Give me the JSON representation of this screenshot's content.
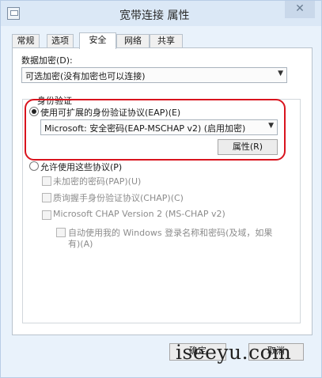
{
  "window": {
    "title": "宽带连接 属性",
    "close_glyph": "✕"
  },
  "tabs": [
    "常规",
    "选项",
    "安全",
    "网络",
    "共享"
  ],
  "active_tab": "安全",
  "security": {
    "encryption_label": "数据加密(D):",
    "encryption_value": "可选加密(没有加密也可以连接)",
    "auth_group_title": "身份验证",
    "eap_radio_label": "使用可扩展的身份验证协议(EAP)(E)",
    "eap_method_value": "Microsoft: 安全密码(EAP-MSCHAP v2) (启用加密)",
    "properties_button": "属性(R)",
    "allow_protocols_label": "允许使用这些协议(P)",
    "protocols": [
      "未加密的密码(PAP)(U)",
      "质询握手身份验证协议(CHAP)(C)",
      "Microsoft CHAP Version 2 (MS-CHAP v2)"
    ],
    "auto_windows_logon_line1": "自动使用我的 Windows 登录名称和密码(及域，如果",
    "auto_windows_logon_line2": "有)(A)"
  },
  "footer": {
    "ok_label": "确定",
    "cancel_label": "取消"
  },
  "watermark": "iseeyu.com",
  "colors": {
    "highlight": "#d9141e",
    "titlebar": "#dbe8f6"
  }
}
